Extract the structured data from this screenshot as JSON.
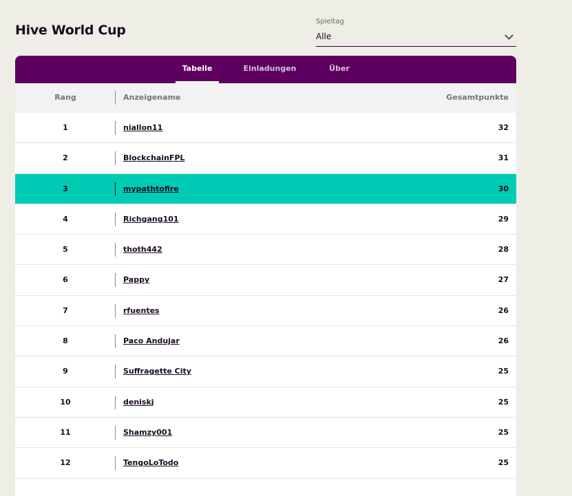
{
  "page": {
    "title": "Hive World Cup"
  },
  "spieltag": {
    "label": "Spieltag",
    "value": "Alle"
  },
  "tabs": [
    {
      "label": "Tabelle",
      "active": true
    },
    {
      "label": "Einladungen",
      "active": false
    },
    {
      "label": "Über",
      "active": false
    }
  ],
  "table": {
    "headers": {
      "rank": "Rang",
      "name": "Anzeigename",
      "points": "Gesamtpunkte"
    },
    "highlight_color": "#00cbb5",
    "rows": [
      {
        "rank": "1",
        "name": "niallon11",
        "points": "32"
      },
      {
        "rank": "2",
        "name": "BlockchainFPL",
        "points": "31"
      },
      {
        "rank": "3",
        "name": "mypathtofire",
        "points": "30",
        "highlight": true
      },
      {
        "rank": "4",
        "name": "Richgang101",
        "points": "29"
      },
      {
        "rank": "5",
        "name": "thoth442",
        "points": "28"
      },
      {
        "rank": "6",
        "name": "Pappy",
        "points": "27"
      },
      {
        "rank": "7",
        "name": "rfuentes",
        "points": "26"
      },
      {
        "rank": "8",
        "name": "Paco Andujar",
        "points": "26"
      },
      {
        "rank": "9",
        "name": "Suffragette City",
        "points": "25"
      },
      {
        "rank": "10",
        "name": "deniskj",
        "points": "25"
      },
      {
        "rank": "11",
        "name": "Shamzy001",
        "points": "25"
      },
      {
        "rank": "12",
        "name": "TengoLoTodo",
        "points": "25"
      }
    ]
  },
  "colors": {
    "brand": "#5d005f",
    "background": "#eeede6"
  }
}
